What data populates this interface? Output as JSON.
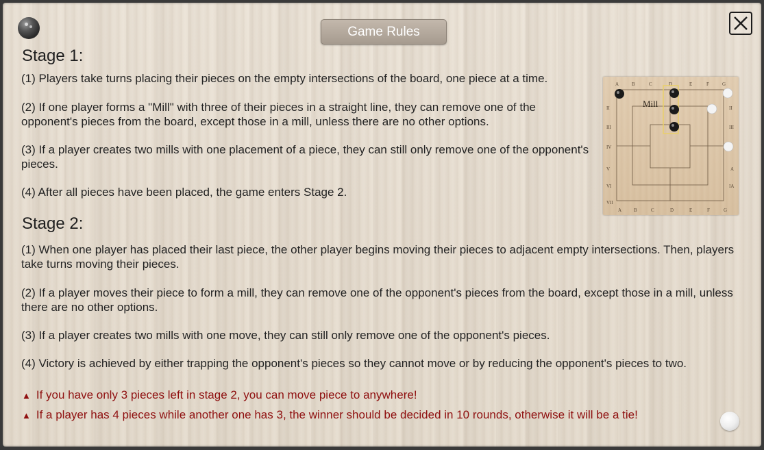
{
  "header": {
    "title": "Game Rules"
  },
  "stage1": {
    "title": "Stage 1:",
    "rules": [
      "(1) Players take turns placing their pieces on the empty intersections of the board, one piece at a time.",
      "(2) If one player forms a \"Mill\" with three of their pieces in a straight line, they can remove one of the opponent's pieces from the board, except those in a mill, unless there are no other options.",
      "(3) If a player creates two mills with one placement of a piece, they can still only remove one of the opponent's pieces.",
      "(4) After all pieces have been placed, the game enters Stage 2."
    ]
  },
  "stage2": {
    "title": "Stage 2:",
    "rules": [
      "(1) When one player has placed their last piece, the other player begins moving their pieces to adjacent empty intersections. Then, players take turns moving their pieces.",
      "(2) If a player moves their piece to form a mill, they can remove one of the opponent's pieces from the board, except those in a mill, unless there are no other options.",
      "(3) If a player creates two mills with one move, they can still only remove one of the opponent's pieces.",
      "(4) Victory is achieved by either trapping the opponent's pieces so they cannot move or by reducing the opponent's pieces to two."
    ]
  },
  "warnings": [
    "If you have only 3 pieces left in stage 2, you can move piece to anywhere!",
    "If a player has 4 pieces while another one has 3, the winner should be decided in 10 rounds, otherwise it will be a tie!"
  ],
  "board_example": {
    "mill_label": "Mill",
    "columns": [
      "A",
      "B",
      "C",
      "D",
      "E",
      "F",
      "G"
    ],
    "rows": [
      "I",
      "II",
      "III",
      "IV",
      "V",
      "VI",
      "VII"
    ]
  },
  "colors": {
    "warning": "#8f1010",
    "text": "#232323",
    "button": "#a69b8f"
  }
}
